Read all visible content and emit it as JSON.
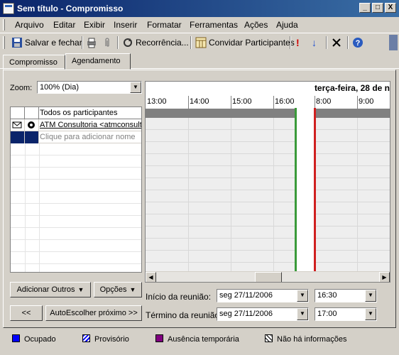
{
  "window": {
    "title": "Sem título - Compromisso",
    "minimize": "_",
    "maximize": "□",
    "close": "X"
  },
  "menu": [
    "Arquivo",
    "Editar",
    "Exibir",
    "Inserir",
    "Formatar",
    "Ferramentas",
    "Ações",
    "Ajuda"
  ],
  "toolbar": {
    "save_close": "Salvar e fechar",
    "recurrence": "Recorrência...",
    "invite": "Convidar Participantes"
  },
  "tabs": [
    "Compromisso",
    "Agendamento"
  ],
  "zoom": {
    "label": "Zoom:",
    "value": "100% (Dia)"
  },
  "attendees": {
    "header": "Todos os participantes",
    "rows": [
      "ATM Consultoria <atmconsult",
      "Clique para adicionar nome"
    ]
  },
  "schedule": {
    "date": "terça-feira, 28 de n",
    "times": [
      "13:00",
      "14:00",
      "15:00",
      "16:00",
      "8:00",
      "9:00"
    ]
  },
  "buttons": {
    "add_others": "Adicionar Outros",
    "options": "Opções",
    "prev": "<<",
    "autopick": "AutoEscolher próximo >>"
  },
  "meeting": {
    "start_label": "Início da reunião:",
    "start_date": "seg 27/11/2006",
    "start_time": "16:30",
    "end_label": "Término da reunião:",
    "end_date": "seg 27/11/2006",
    "end_time": "17:00"
  },
  "legend": [
    "Ocupado",
    "Provisório",
    "Ausência temporária",
    "Não há informações"
  ],
  "colors": {
    "busy": "#0000ff",
    "tentative": "#0000ff",
    "oof": "#800080",
    "start": "#3a9a3a",
    "end": "#d02020"
  }
}
